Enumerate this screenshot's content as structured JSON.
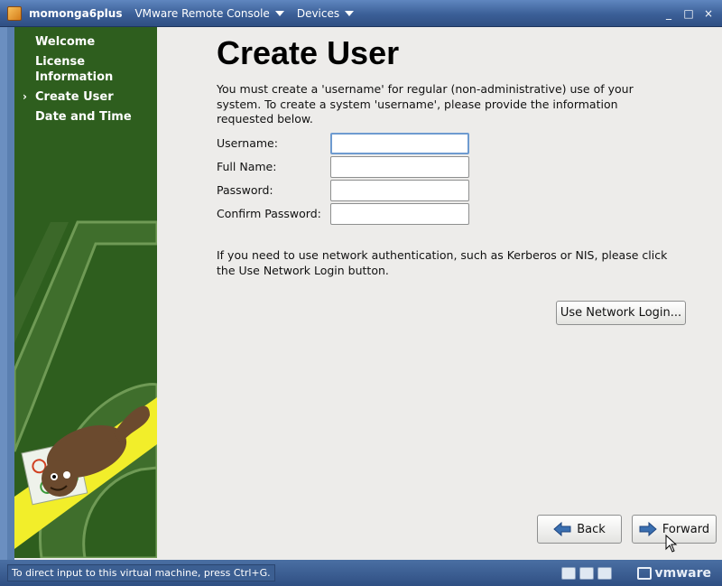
{
  "window": {
    "title": "momonga6plus",
    "menus": [
      "VMware Remote Console",
      "Devices"
    ],
    "controls": [
      "_",
      "□",
      "×"
    ]
  },
  "sidebar": {
    "steps": [
      {
        "label": "Welcome",
        "current": false
      },
      {
        "label": "License Information",
        "current": false
      },
      {
        "label": "Create User",
        "current": true
      },
      {
        "label": "Date and Time",
        "current": false
      }
    ],
    "current_marker": "›"
  },
  "main": {
    "title": "Create User",
    "intro": "You must create a 'username' for regular (non-administrative) use of your system.  To create a system 'username', please provide the information requested below.",
    "fields": [
      {
        "label": "Username:",
        "value": ""
      },
      {
        "label": "Full Name:",
        "value": ""
      },
      {
        "label": "Password:",
        "value": ""
      },
      {
        "label": "Confirm Password:",
        "value": ""
      }
    ],
    "network_info": "If you need to use network authentication, such as Kerberos or NIS, please click the Use Network Login button.",
    "network_button": "Use Network Login...",
    "back_button": "Back",
    "forward_button": "Forward"
  },
  "statusbar": {
    "hint": "To direct input to this virtual machine, press Ctrl+G.",
    "brand": "vmware"
  },
  "colors": {
    "sidebar_green": "#2e5e1e",
    "accent_yellow": "#f2ee2a",
    "titlebar_blue": "#3b5f97"
  }
}
